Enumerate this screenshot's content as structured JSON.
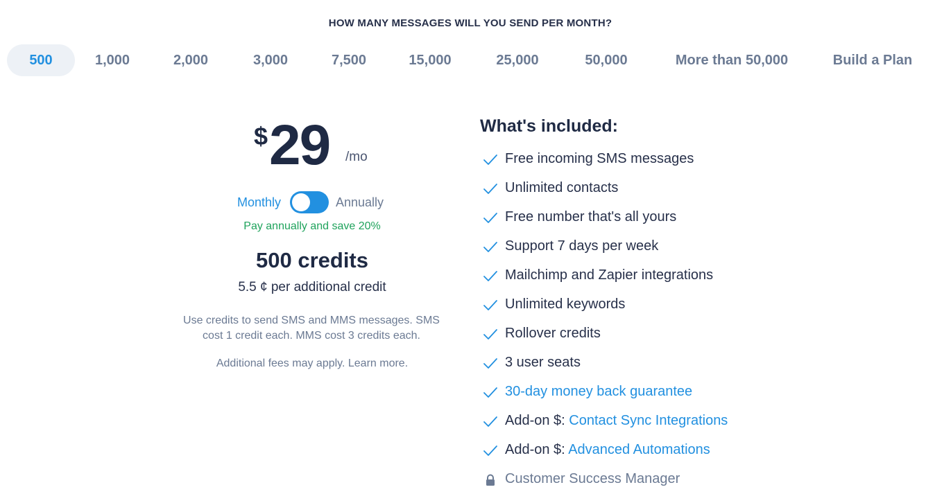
{
  "question": "HOW MANY MESSAGES WILL YOU SEND PER MONTH?",
  "tiers": [
    "500",
    "1,000",
    "2,000",
    "3,000",
    "7,500",
    "15,000",
    "25,000",
    "50,000",
    "More than 50,000",
    "Build a Plan"
  ],
  "selected_tier": "500",
  "price": {
    "currency": "$",
    "amount": "29",
    "period": "/mo"
  },
  "billing": {
    "monthly_label": "Monthly",
    "annually_label": "Annually",
    "selected": "Monthly",
    "save_text": "Pay annually and save 20%"
  },
  "credits": {
    "title": "500 credits",
    "additional": "5.5 ¢ per additional credit",
    "description": "Use credits to send SMS and MMS messages. SMS cost 1 credit each. MMS cost 3 credits each.",
    "fees": "Additional fees may apply. Learn more."
  },
  "included": {
    "title": "What's included:",
    "features": [
      {
        "prefix": "",
        "text": "Free incoming SMS messages",
        "link": false,
        "icon": "check-icon"
      },
      {
        "prefix": "",
        "text": "Unlimited contacts",
        "link": false,
        "icon": "check-icon"
      },
      {
        "prefix": "",
        "text": "Free number that's all yours",
        "link": false,
        "icon": "check-icon"
      },
      {
        "prefix": "",
        "text": "Support 7 days per week",
        "link": false,
        "icon": "check-icon"
      },
      {
        "prefix": "",
        "text": "Mailchimp and Zapier integrations",
        "link": false,
        "icon": "check-icon"
      },
      {
        "prefix": "",
        "text": "Unlimited keywords",
        "link": false,
        "icon": "check-icon"
      },
      {
        "prefix": "",
        "text": "Rollover credits",
        "link": false,
        "icon": "check-icon"
      },
      {
        "prefix": "",
        "text": "3 user seats",
        "link": false,
        "icon": "check-icon"
      },
      {
        "prefix": "",
        "text": "30-day money back guarantee",
        "link": true,
        "icon": "check-icon"
      },
      {
        "prefix": "Add-on $: ",
        "text": "Contact Sync Integrations",
        "link": true,
        "icon": "check-icon"
      },
      {
        "prefix": "Add-on $: ",
        "text": "Advanced Automations",
        "link": true,
        "icon": "check-icon"
      },
      {
        "prefix": "",
        "text": "Customer Success Manager",
        "link": false,
        "icon": "lock-icon"
      }
    ]
  },
  "colors": {
    "accent": "#2290e0",
    "save_green": "#1fa35c",
    "heading": "#1f2a44",
    "muted": "#6b7a93"
  }
}
